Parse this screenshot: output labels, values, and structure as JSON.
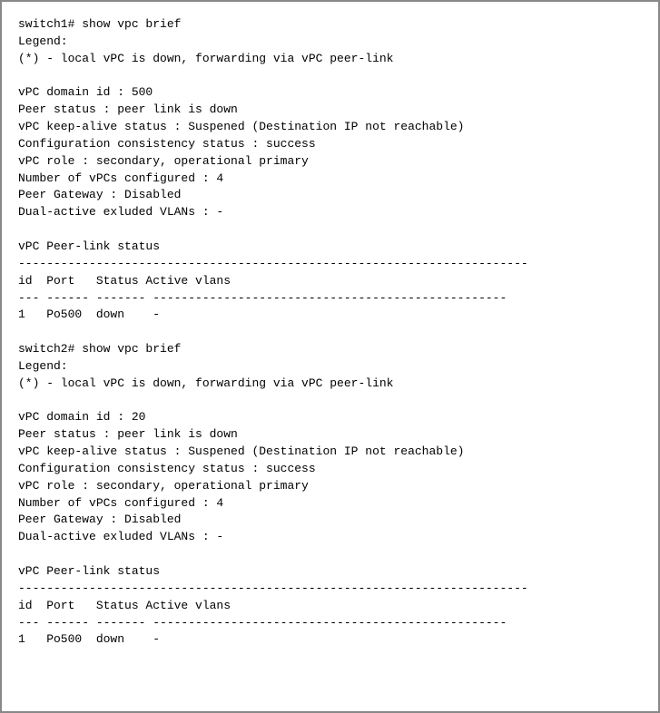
{
  "terminal": {
    "lines": [
      "switch1# show vpc brief",
      "Legend:",
      "(*) - local vPC is down, forwarding via vPC peer-link",
      "",
      "vPC domain id : 500",
      "Peer status : peer link is down",
      "vPC keep-alive status : Suspened (Destination IP not reachable)",
      "Configuration consistency status : success",
      "vPC role : secondary, operational primary",
      "Number of vPCs configured : 4",
      "Peer Gateway : Disabled",
      "Dual-active exluded VLANs : -",
      "",
      "vPC Peer-link status",
      "------------------------------------------------------------------------",
      "id  Port   Status Active vlans",
      "--- ------ ------- --------------------------------------------------",
      "1   Po500  down    -",
      "",
      "switch2# show vpc brief",
      "Legend:",
      "(*) - local vPC is down, forwarding via vPC peer-link",
      "",
      "vPC domain id : 20",
      "Peer status : peer link is down",
      "vPC keep-alive status : Suspened (Destination IP not reachable)",
      "Configuration consistency status : success",
      "vPC role : secondary, operational primary",
      "Number of vPCs configured : 4",
      "Peer Gateway : Disabled",
      "Dual-active exluded VLANs : -",
      "",
      "vPC Peer-link status",
      "------------------------------------------------------------------------",
      "id  Port   Status Active vlans",
      "--- ------ ------- --------------------------------------------------",
      "1   Po500  down    -"
    ]
  }
}
